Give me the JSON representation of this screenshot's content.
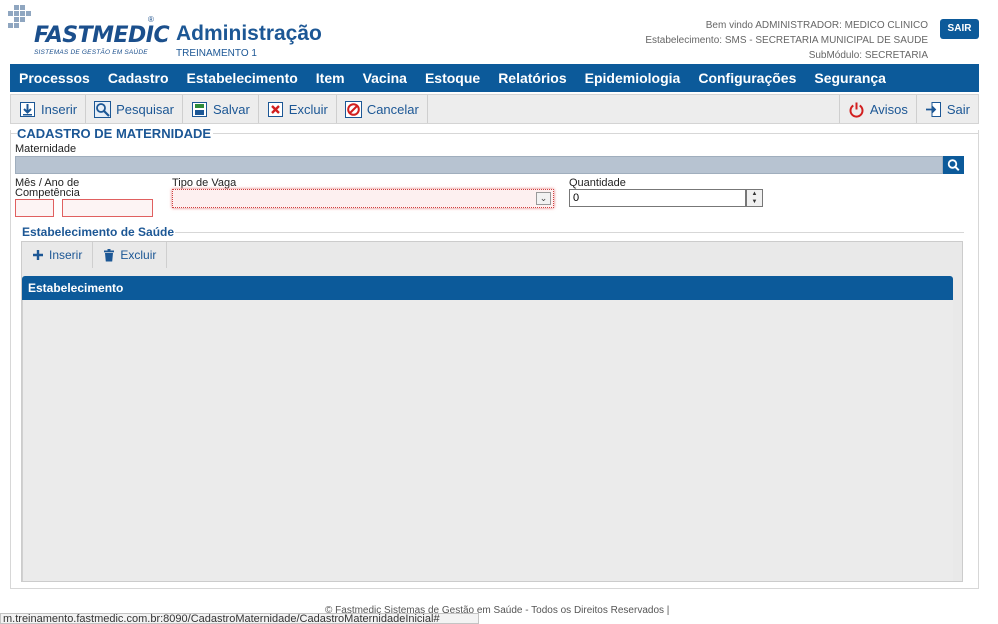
{
  "header": {
    "brand": "FASTMEDIC",
    "brand_tagline": "SISTEMAS DE GESTÃO EM SAÚDE",
    "brand_reg": "®",
    "app_title": "Administração",
    "environment": "TREINAMENTO 1",
    "welcome": "Bem vindo ADMINISTRADOR: MEDICO CLINICO",
    "establishment": "Estabelecimento: SMS - SECRETARIA MUNICIPAL DE SAUDE",
    "submodule": "SubMódulo: SECRETARIA",
    "logout_label": "SAIR"
  },
  "menu": {
    "items": [
      "Processos",
      "Cadastro",
      "Estabelecimento",
      "Item",
      "Vacina",
      "Estoque",
      "Relatórios",
      "Epidemiologia",
      "Configurações",
      "Segurança"
    ]
  },
  "toolbar": {
    "insert": "Inserir",
    "search": "Pesquisar",
    "save": "Salvar",
    "delete": "Excluir",
    "cancel": "Cancelar",
    "alerts": "Avisos",
    "exit": "Sair"
  },
  "form": {
    "title": "CADASTRO DE MATERNIDADE",
    "maternidade_label": "Maternidade",
    "maternidade_value": "",
    "competencia_label_line1": "Mês / Ano de",
    "competencia_label_line2": "Competência",
    "mes_value": "",
    "ano_value": "",
    "tipo_vaga_label": "Tipo de Vaga",
    "tipo_vaga_value": "",
    "quantidade_label": "Quantidade",
    "quantidade_value": "0"
  },
  "establishments": {
    "title": "Estabelecimento de Saúde",
    "insert": "Inserir",
    "delete": "Excluir",
    "columns": [
      "Estabelecimento"
    ],
    "rows": []
  },
  "footer": {
    "text": "© Fastmedic Sistemas de Gestão em Saúde - Todos os Direitos Reservados |"
  },
  "statusbar": {
    "url": "m.treinamento.fastmedic.com.br:8090/CadastroMaternidade/CadastroMaternidadeInicial#"
  },
  "colors": {
    "primary": "#0c5a9a",
    "title": "#1c5795",
    "required_border": "#e06060"
  }
}
